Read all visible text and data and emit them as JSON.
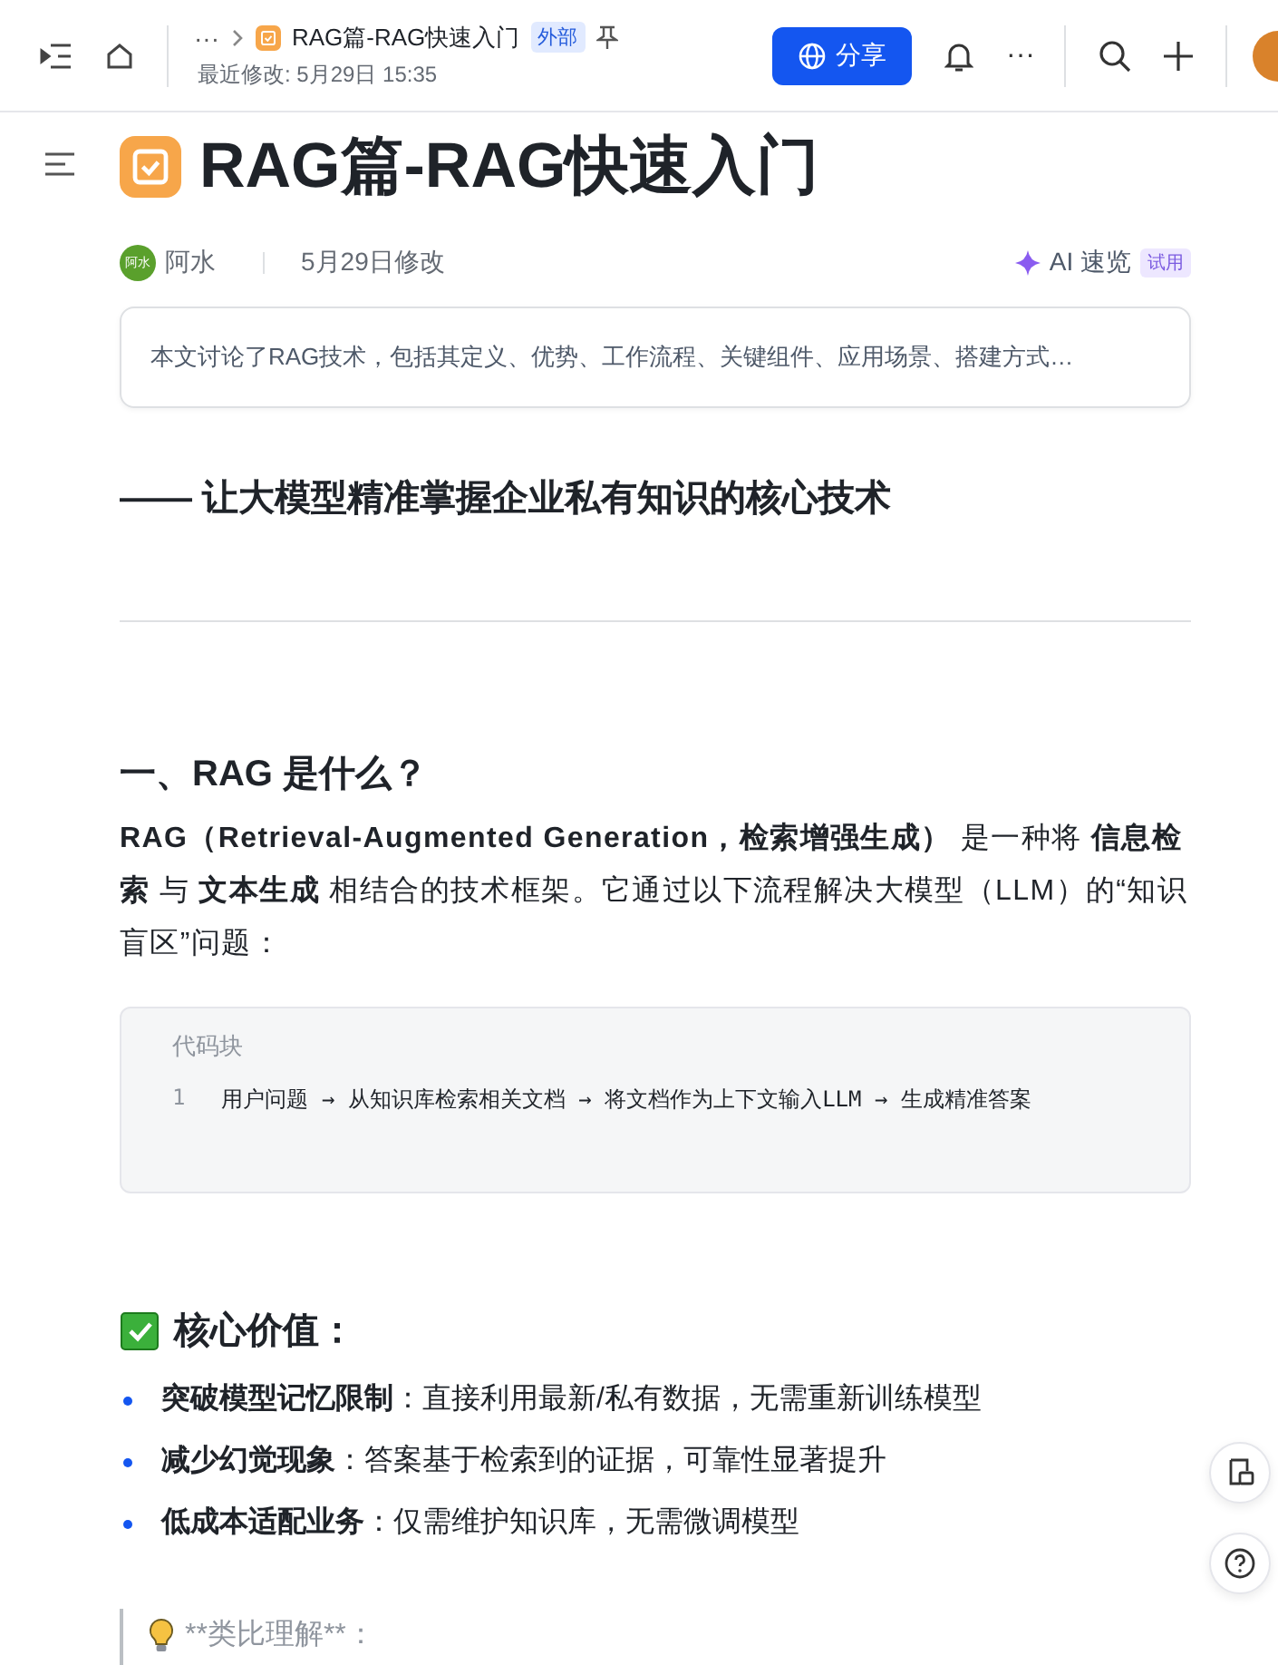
{
  "topbar": {
    "more": "···",
    "doc_title": "RAG篇-RAG快速入门",
    "tag": "外部",
    "modified": "最近修改: 5月29日 15:35",
    "share": "分享",
    "actions_more": "···"
  },
  "doc": {
    "title": "RAG篇-RAG快速入门",
    "author": {
      "name": "阿水",
      "avatar_text": "阿水"
    },
    "modified": "5月29日修改",
    "ai": {
      "label": "AI 速览",
      "badge": "试用"
    },
    "summary": "本文讨论了RAG技术，包括其定义、优势、工作流程、关键组件、应用场景、搭建方式…",
    "blocks": [
      {
        "kind": "subtitle",
        "text": "—— 让大模型精准掌握企业私有知识的核心技术"
      },
      {
        "kind": "divider"
      },
      {
        "kind": "heading",
        "text": "一、RAG 是什么？"
      },
      {
        "kind": "paragraph",
        "text": "**RAG（Retrieval-Augmented Generation，检索增强生成）** 是一种将 **信息检索** 与 **文本生成** 相结合的技术框架。它通过以下流程解决大模型（LLM）的“知识盲区”问题："
      },
      {
        "kind": "code",
        "label": "代码块",
        "lines": [
          {
            "number": "1",
            "text": "用户问题 → 从知识库检索相关文档 → 将文档作为上下文输入LLM → 生成精准答案"
          }
        ]
      },
      {
        "kind": "check_heading",
        "text": "核心价值："
      },
      {
        "kind": "bullets",
        "items": [
          "**突破模型记忆限制**：直接利用最新/私有数据，无需重新训练模型",
          "**减少幻觉现象**：答案基于检索到的证据，可靠性显著提升",
          "**低成本适配业务**：仅需维护知识库，无需微调模型"
        ]
      },
      {
        "kind": "callout",
        "text": "**类比理解**："
      }
    ]
  }
}
